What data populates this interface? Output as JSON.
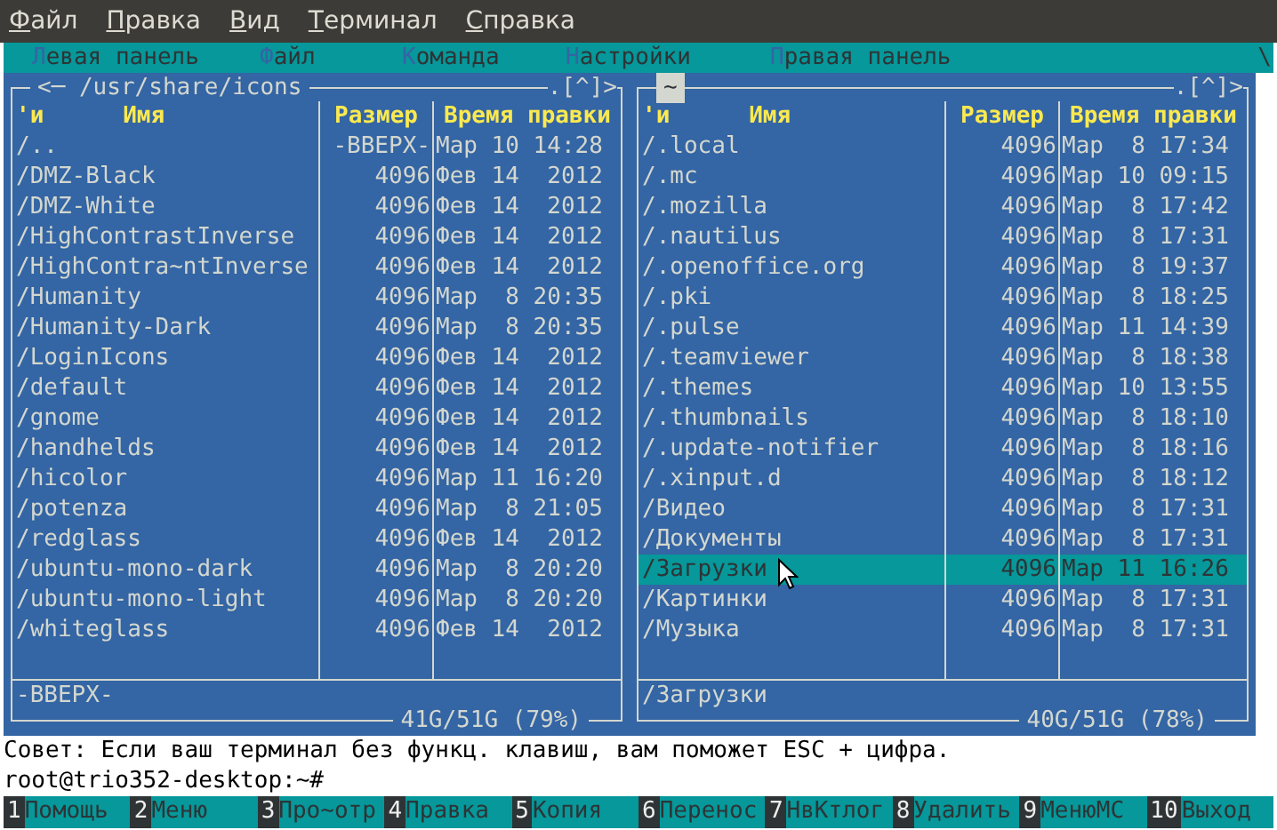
{
  "menubar": [
    "Файл",
    "Правка",
    "Вид",
    "Терминал",
    "Справка"
  ],
  "mc_menu": {
    "items": [
      "Левая панель",
      "Файл",
      "Команда",
      "Настройки",
      "Правая панель"
    ],
    "edge_mark": "\\"
  },
  "panels": [
    {
      "active": false,
      "title": "<─ /usr/share/icons",
      "title_right": ".[^]>",
      "sort_mark": "'и",
      "columns": [
        "Имя",
        "Размер",
        "Время правки"
      ],
      "rows": [
        {
          "name": "/..",
          "size": "-ВВЕРХ-",
          "date": "Мар 10 14:28",
          "selected": false
        },
        {
          "name": "/DMZ-Black",
          "size": "4096",
          "date": "Фев 14  2012",
          "selected": false
        },
        {
          "name": "/DMZ-White",
          "size": "4096",
          "date": "Фев 14  2012",
          "selected": false
        },
        {
          "name": "/HighContrastInverse",
          "size": "4096",
          "date": "Фев 14  2012",
          "selected": false
        },
        {
          "name": "/HighContra~ntInverse",
          "size": "4096",
          "date": "Фев 14  2012",
          "selected": false
        },
        {
          "name": "/Humanity",
          "size": "4096",
          "date": "Мар  8 20:35",
          "selected": false
        },
        {
          "name": "/Humanity-Dark",
          "size": "4096",
          "date": "Мар  8 20:35",
          "selected": false
        },
        {
          "name": "/LoginIcons",
          "size": "4096",
          "date": "Фев 14  2012",
          "selected": false
        },
        {
          "name": "/default",
          "size": "4096",
          "date": "Фев 14  2012",
          "selected": false
        },
        {
          "name": "/gnome",
          "size": "4096",
          "date": "Фев 14  2012",
          "selected": false
        },
        {
          "name": "/handhelds",
          "size": "4096",
          "date": "Фев 14  2012",
          "selected": false
        },
        {
          "name": "/hicolor",
          "size": "4096",
          "date": "Мар 11 16:20",
          "selected": false
        },
        {
          "name": "/potenza",
          "size": "4096",
          "date": "Мар  8 21:05",
          "selected": false
        },
        {
          "name": "/redglass",
          "size": "4096",
          "date": "Фев 14  2012",
          "selected": false
        },
        {
          "name": "/ubuntu-mono-dark",
          "size": "4096",
          "date": "Мар  8 20:20",
          "selected": false
        },
        {
          "name": "/ubuntu-mono-light",
          "size": "4096",
          "date": "Мар  8 20:20",
          "selected": false
        },
        {
          "name": "/whiteglass",
          "size": "4096",
          "date": "Фев 14  2012",
          "selected": false
        }
      ],
      "info": "-ВВЕРХ-",
      "disk": "41G/51G (79%)"
    },
    {
      "active": true,
      "title": "~",
      "title_right": ".[^]>",
      "sort_mark": "'и",
      "columns": [
        "Имя",
        "Размер",
        "Время правки"
      ],
      "rows": [
        {
          "name": "/.local",
          "size": "4096",
          "date": "Мар  8 17:34",
          "selected": false
        },
        {
          "name": "/.mc",
          "size": "4096",
          "date": "Мар 10 09:15",
          "selected": false
        },
        {
          "name": "/.mozilla",
          "size": "4096",
          "date": "Мар  8 17:42",
          "selected": false
        },
        {
          "name": "/.nautilus",
          "size": "4096",
          "date": "Мар  8 17:31",
          "selected": false
        },
        {
          "name": "/.openoffice.org",
          "size": "4096",
          "date": "Мар  8 19:37",
          "selected": false
        },
        {
          "name": "/.pki",
          "size": "4096",
          "date": "Мар  8 18:25",
          "selected": false
        },
        {
          "name": "/.pulse",
          "size": "4096",
          "date": "Мар 11 14:39",
          "selected": false
        },
        {
          "name": "/.teamviewer",
          "size": "4096",
          "date": "Мар  8 18:38",
          "selected": false
        },
        {
          "name": "/.themes",
          "size": "4096",
          "date": "Мар 10 13:55",
          "selected": false
        },
        {
          "name": "/.thumbnails",
          "size": "4096",
          "date": "Мар  8 18:10",
          "selected": false
        },
        {
          "name": "/.update-notifier",
          "size": "4096",
          "date": "Мар  8 18:16",
          "selected": false
        },
        {
          "name": "/.xinput.d",
          "size": "4096",
          "date": "Мар  8 18:12",
          "selected": false
        },
        {
          "name": "/Видео",
          "size": "4096",
          "date": "Мар  8 17:31",
          "selected": false
        },
        {
          "name": "/Документы",
          "size": "4096",
          "date": "Мар  8 17:31",
          "selected": false
        },
        {
          "name": "/Загрузки",
          "size": "4096",
          "date": "Мар 11 16:26",
          "selected": true
        },
        {
          "name": "/Картинки",
          "size": "4096",
          "date": "Мар  8 17:31",
          "selected": false
        },
        {
          "name": "/Музыка",
          "size": "4096",
          "date": "Мар  8 17:31",
          "selected": false
        }
      ],
      "info": "/Загрузки",
      "disk": "40G/51G (78%)"
    }
  ],
  "hint": "Совет: Если ваш терминал без функц. клавиш, вам поможет ESC + цифра.",
  "prompt": "root@trio352-desktop:~#",
  "keybar": [
    {
      "num": "1",
      "label": "Помощь"
    },
    {
      "num": "2",
      "label": "Меню"
    },
    {
      "num": "3",
      "label": "Про~отр"
    },
    {
      "num": "4",
      "label": "Правка"
    },
    {
      "num": "5",
      "label": "Копия"
    },
    {
      "num": "6",
      "label": "Перенос"
    },
    {
      "num": "7",
      "label": "НвКтлог"
    },
    {
      "num": "8",
      "label": "Удалить"
    },
    {
      "num": "9",
      "label": "МенюМС"
    },
    {
      "num": "10",
      "label": "Выход"
    }
  ]
}
